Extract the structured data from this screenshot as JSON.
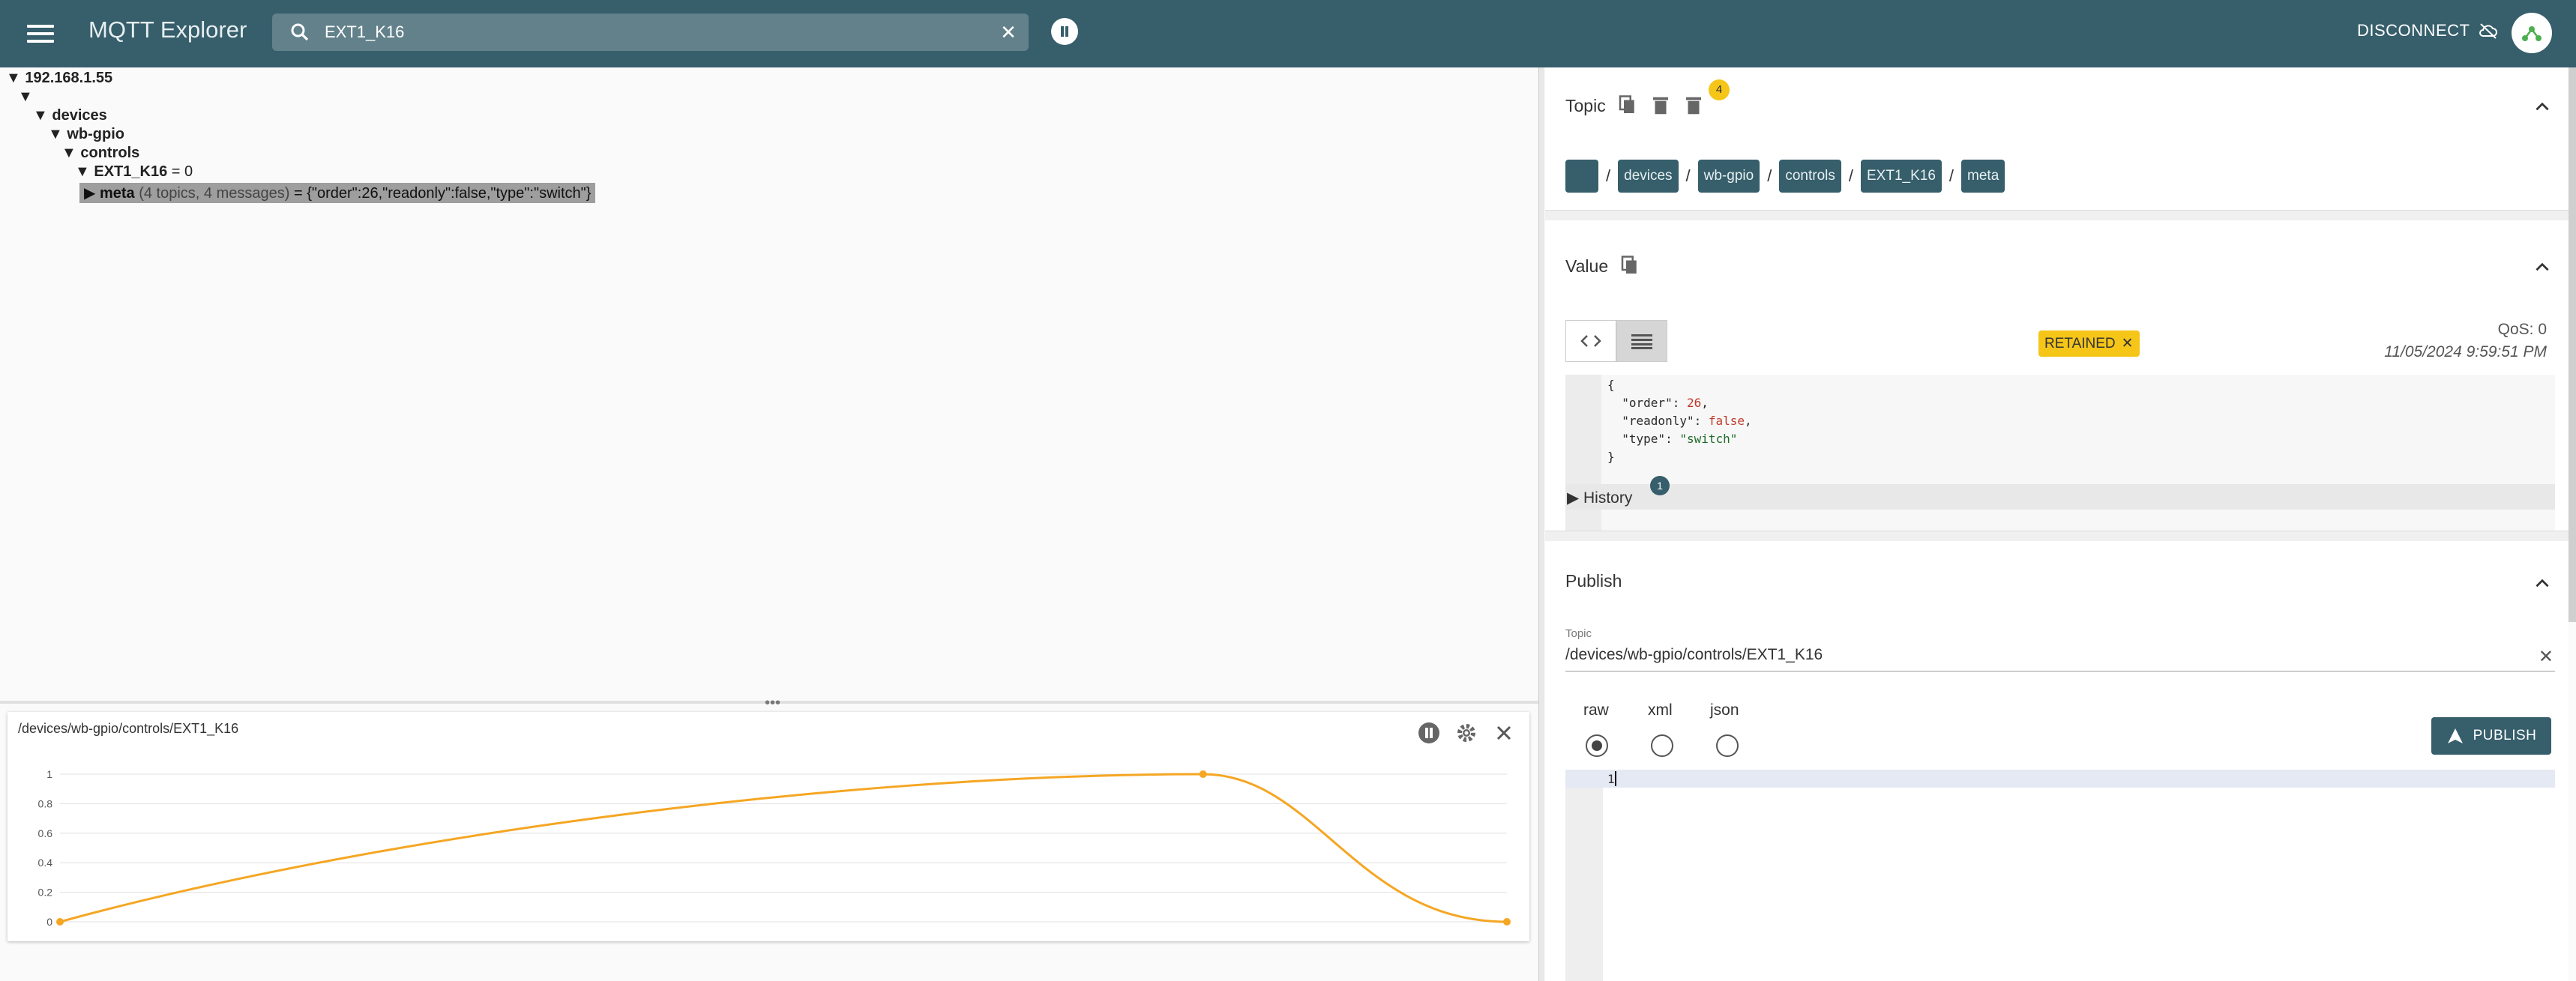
{
  "app": {
    "title": "MQTT Explorer"
  },
  "search": {
    "value": "EXT1_K16",
    "clear_glyph": "✕"
  },
  "header": {
    "disconnect_label": "DISCONNECT"
  },
  "tree": {
    "root": "192.168.1.55",
    "devices": "devices",
    "wbgpio": "wb-gpio",
    "controls": "controls",
    "ext_name": "EXT1_K16",
    "ext_value": " = 0",
    "meta_name": "meta",
    "meta_sub": "(4 topics, 4 messages)",
    "meta_value": " = {\"order\":26,\"readonly\":false,\"type\":\"switch\"}"
  },
  "topic_section": {
    "title": "Topic",
    "delete_badge": "4",
    "breadcrumbs": [
      "",
      "devices",
      "wb-gpio",
      "controls",
      "EXT1_K16",
      "meta"
    ],
    "sep": "/"
  },
  "value_section": {
    "title": "Value",
    "retained_label": "RETAINED",
    "qos": "QoS: 0",
    "timestamp": "11/05/2024 9:59:51 PM",
    "code_lines": {
      "l1": "{",
      "l2_key": "  \"order\": ",
      "l2_val": "26",
      "l2_end": ",",
      "l3_key": "  \"readonly\": ",
      "l3_val": "false",
      "l3_end": ",",
      "l4_key": "  \"type\": ",
      "l4_val": "\"switch\"",
      "l5": "}"
    },
    "history_label": "▶ History",
    "history_count": "1"
  },
  "publish_section": {
    "title": "Publish",
    "topic_label": "Topic",
    "topic_value": "/devices/wb-gpio/controls/EXT1_K16",
    "formats": [
      "raw",
      "xml",
      "json"
    ],
    "selected_format": "raw",
    "publish_label": "PUBLISH",
    "editor_line_number": "1"
  },
  "chart_panel": {
    "title": "/devices/wb-gpio/controls/EXT1_K16"
  },
  "colors": {
    "appbar": "#365e6b",
    "accent": "#f5a623",
    "badge": "#f5c518"
  },
  "chart_data": {
    "type": "line",
    "title": "/devices/wb-gpio/controls/EXT1_K16",
    "x": [
      0,
      0.79,
      1
    ],
    "values": [
      0,
      1,
      0
    ],
    "ylim": [
      0,
      1
    ],
    "yticks": [
      "0",
      "0.2",
      "0.4",
      "0.6",
      "0.8",
      "1"
    ],
    "xlabel": "",
    "ylabel": "",
    "grid": true,
    "color": "#f5a623"
  }
}
